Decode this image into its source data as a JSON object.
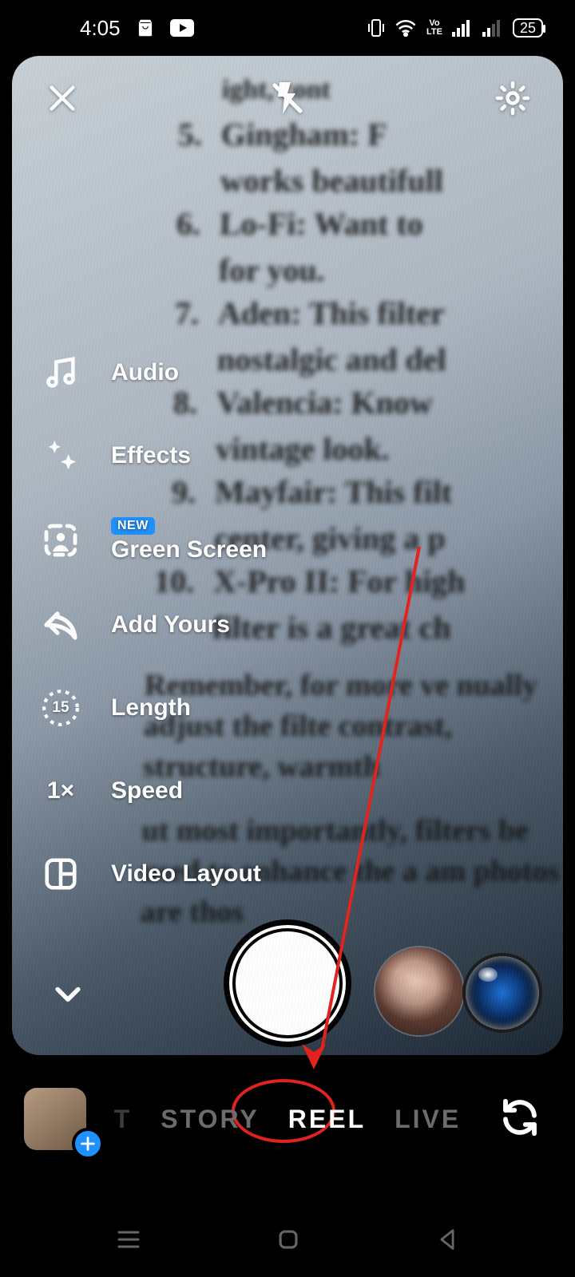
{
  "status": {
    "time": "4:05",
    "battery": "25"
  },
  "background_text": {
    "items": [
      {
        "num": "5.",
        "line1": "Gingham:  F",
        "line2": "works beautifull"
      },
      {
        "num": "6.",
        "line1": "Lo-Fi: Want to ",
        "line2": "for you."
      },
      {
        "num": "7.",
        "line1": "Aden: This filter",
        "line2": "nostalgic and del"
      },
      {
        "num": "8.",
        "line1": "Valencia: Know",
        "line2": "vintage look."
      },
      {
        "num": "9.",
        "line1": "Mayfair: This filt",
        "line2": "center, giving a p"
      },
      {
        "num": "10.",
        "line1": "X-Pro II: For high ",
        "line2": "filter is a great ch"
      }
    ],
    "para1": "Remember,  for  more  ve  nually  adjust  the  filte  contrast,  structure,  warmth",
    "para2": "ut most importantly, filters be used to enhance the a  am photos are thos"
  },
  "tools": {
    "audio": "Audio",
    "effects": "Effects",
    "greenscreen_badge": "NEW",
    "greenscreen": "Green Screen",
    "addyours": "Add Yours",
    "length": "Length",
    "length_value": "15",
    "speed": "Speed",
    "speed_value": "1×",
    "layout": "Video Layout"
  },
  "modes": {
    "post_partial": "T",
    "story": "STORY",
    "reel": "REEL",
    "live": "LIVE"
  }
}
